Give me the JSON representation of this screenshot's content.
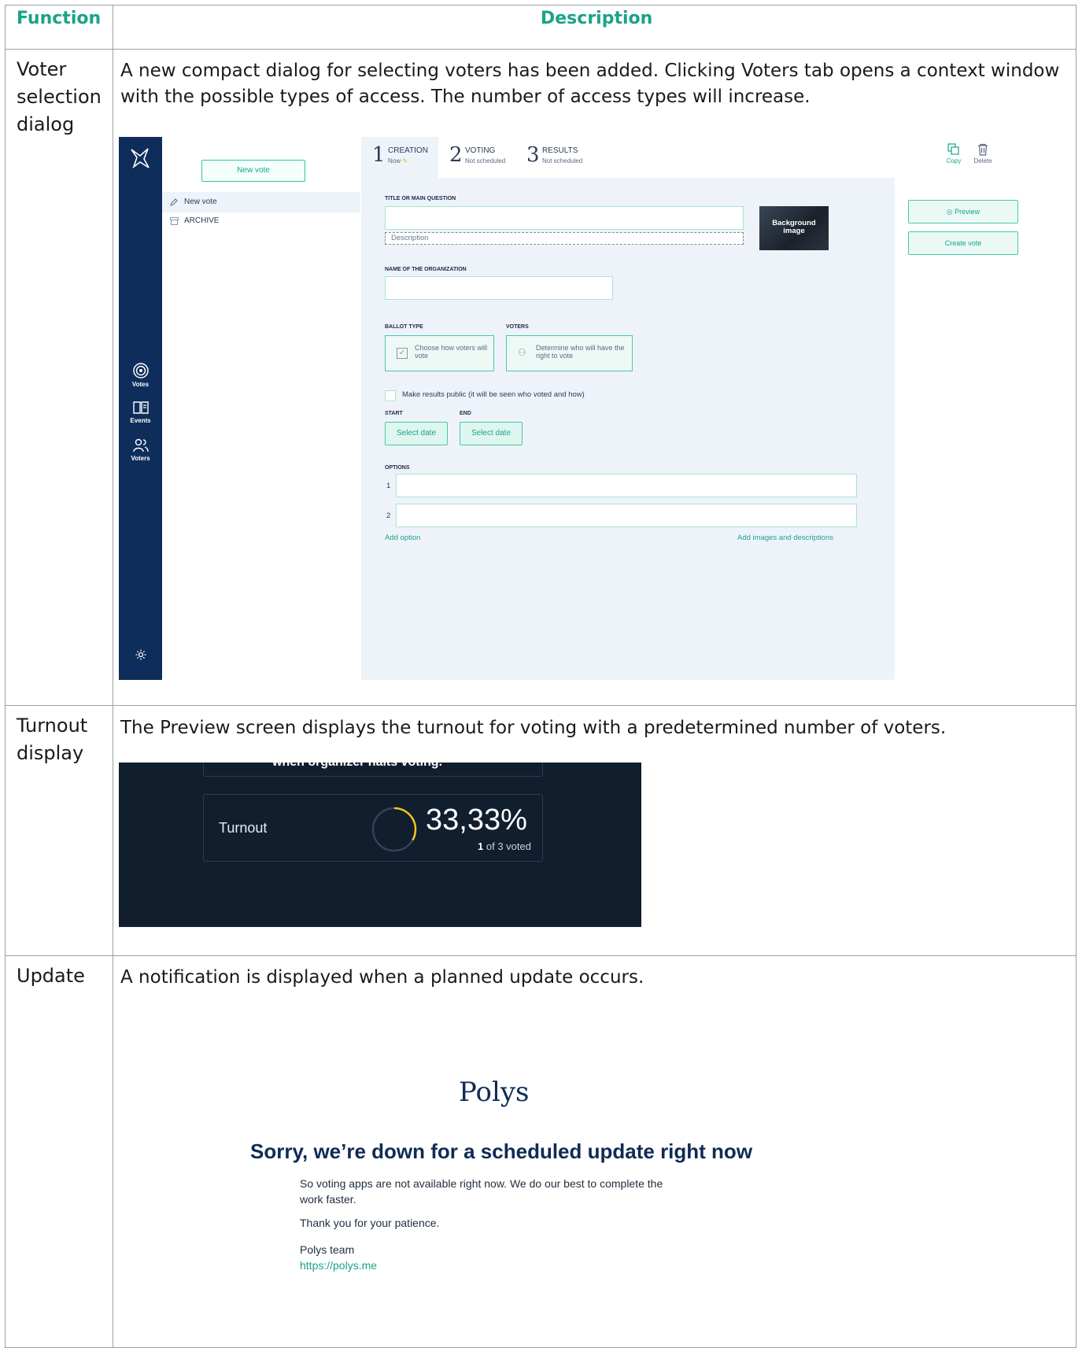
{
  "table": {
    "headers": {
      "function": "Function",
      "description": "Description"
    },
    "rows": [
      {
        "function_lines": [
          "Voter",
          "selection",
          "dialog"
        ],
        "description_lines": [
          "A new compact dialog for selecting voters has been added. Clicking Voters tab opens a context window",
          "with the possible types of access. The number of access types will increase."
        ]
      },
      {
        "function_lines": [
          "Turnout",
          "display"
        ],
        "description_lines": [
          "The Preview screen displays the turnout for voting with a predetermined number of voters."
        ]
      },
      {
        "function_lines": [
          "Update"
        ],
        "description_lines": [
          "A notification is displayed when a planned update occurs."
        ]
      }
    ]
  },
  "vote_app": {
    "sidebar": {
      "items": [
        {
          "label": "Votes",
          "icon": "target-icon"
        },
        {
          "label": "Events",
          "icon": "book-icon"
        },
        {
          "label": "Voters",
          "icon": "people-icon"
        }
      ],
      "settings_icon": "gear-icon"
    },
    "list": {
      "new_vote_button": "New vote",
      "rows": [
        {
          "label": "New vote",
          "icon": "pencil-icon"
        },
        {
          "label": "ARCHIVE",
          "icon": "archive-icon"
        }
      ]
    },
    "steps": [
      {
        "num": "1",
        "title": "CREATION",
        "status": "Now"
      },
      {
        "num": "2",
        "title": "VOTING",
        "status": "Not scheduled"
      },
      {
        "num": "3",
        "title": "RESULTS",
        "status": "Not scheduled"
      }
    ],
    "actions": {
      "copy": "Copy",
      "delete": "Delete",
      "preview": "Preview",
      "create": "Create vote"
    },
    "form": {
      "title_label": "TITLE OR MAIN QUESTION",
      "description_placeholder": "Description",
      "background_image": "Background image",
      "org_label": "NAME OF THE ORGANIZATION",
      "ballot_label": "BALLOT TYPE",
      "ballot_text": "Choose how voters will vote",
      "voters_label": "VOTERS",
      "voters_text": "Determine who will have the right to vote",
      "public_results": "Make results public (it will be seen who voted and how)",
      "start_label": "START",
      "end_label": "END",
      "select_date": "Select date",
      "options_label": "OPTIONS",
      "option_numbers": [
        "1",
        "2"
      ],
      "add_option": "Add option",
      "add_images": "Add images and descriptions"
    }
  },
  "turnout": {
    "cut_text": "when organizer halts voting.",
    "label": "Turnout",
    "percent": "33,33%",
    "voted": "1",
    "of_text": "of 3 voted",
    "fraction": 0.3333,
    "accent": "#f5c518"
  },
  "update": {
    "brand": "Polys",
    "title": "Sorry, we’re down for a scheduled update right now",
    "line1": "So voting apps are not available right now. We do our best to complete the",
    "line2": "work faster.",
    "thanks": "Thank you for your patience.",
    "team": "Polys team",
    "link": "https://polys.me"
  }
}
